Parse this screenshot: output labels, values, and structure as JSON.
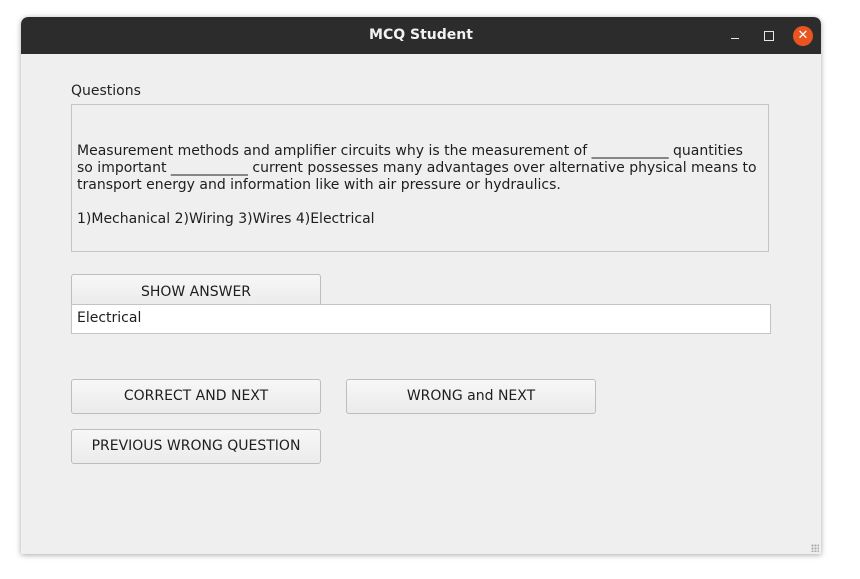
{
  "window": {
    "title": "MCQ Student",
    "controls": {
      "minimize": "minimize-icon",
      "maximize": "maximize-icon",
      "close": "close-icon",
      "close_color": "#e95420"
    }
  },
  "questions": {
    "label": "Questions",
    "text": "Measurement methods and amplifier circuits  why is the measurement of ___________ quantities so important ___________ current possesses many advantages over alternative physical means to transport energy and information like with air pressure or hydraulics.",
    "options": "1)Mechanical 2)Wiring 3)Wires 4)Electrical"
  },
  "answer": {
    "show_label": "SHOW ANSWER",
    "value": "Electrical"
  },
  "actions": {
    "correct_label": "CORRECT AND NEXT",
    "wrong_label": "WRONG and NEXT",
    "previous_label": "PREVIOUS WRONG QUESTION"
  }
}
